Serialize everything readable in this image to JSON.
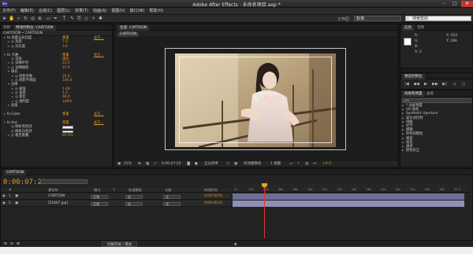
{
  "app": {
    "title": "Adobe After Effects - 未命名项目.aep *",
    "icon": "Ae"
  },
  "menu": [
    "文件(F)",
    "编辑(E)",
    "合成(C)",
    "图层(L)",
    "效果(T)",
    "动画(A)",
    "视图(V)",
    "窗口(W)",
    "帮助(H)"
  ],
  "toolbar": {
    "workspace_label": "工作区:",
    "workspace_value": "标准",
    "search_value": "搜索帮助"
  },
  "effects": {
    "tabs": [
      "项目",
      "特效控制台: CARTOON"
    ],
    "header": "CARTOON • CARTOON",
    "rows": [
      {
        "level": 0,
        "twirl": "▾",
        "name": "fx 亮度与对比度",
        "value": "重置",
        "about": "关于..."
      },
      {
        "level": 1,
        "twirl": "▸",
        "name": "◎ 亮度",
        "value": "7.0"
      },
      {
        "level": 1,
        "twirl": "▸",
        "name": "◎ 对比度",
        "value": "3.0"
      },
      {
        "level": 0,
        "twirl": "",
        "name": "",
        "value": ""
      },
      {
        "level": 0,
        "twirl": "▾",
        "name": "fx 卡通",
        "value": "重置",
        "about": "关于..."
      },
      {
        "level": 1,
        "twirl": "",
        "name": "◎ 渲染",
        "value": "填充"
      },
      {
        "level": 1,
        "twirl": "▸",
        "name": "◎ 详细半径",
        "value": "22.0"
      },
      {
        "level": 1,
        "twirl": "▸",
        "name": "◎ 详细阈值",
        "value": "15.0"
      },
      {
        "level": 1,
        "twirl": "▾",
        "name": "填充",
        "value": ""
      },
      {
        "level": 2,
        "twirl": "▸",
        "name": "◎ 阴影步数",
        "value": "25.0"
      },
      {
        "level": 2,
        "twirl": "▸",
        "name": "◎ 阴影平滑度",
        "value": "100.0"
      },
      {
        "level": 1,
        "twirl": "▾",
        "name": "边缘",
        "value": ""
      },
      {
        "level": 2,
        "twirl": "▸",
        "name": "◎ 阈值",
        "value": "1.00"
      },
      {
        "level": 2,
        "twirl": "▸",
        "name": "◎ 宽度",
        "value": "1.0"
      },
      {
        "level": 2,
        "twirl": "▸",
        "name": "◎ 柔化",
        "value": "60.0"
      },
      {
        "level": 2,
        "twirl": "▸",
        "name": "◎ 透明度",
        "value": "100%"
      },
      {
        "level": 1,
        "twirl": "▸",
        "name": "高级",
        "value": ""
      },
      {
        "level": 0,
        "twirl": "",
        "name": "",
        "value": ""
      },
      {
        "level": 0,
        "twirl": "▸",
        "name": "fx Color",
        "value": "重置",
        "about": "关于..."
      },
      {
        "level": 0,
        "twirl": "",
        "name": "",
        "value": ""
      },
      {
        "level": 0,
        "twirl": "▾",
        "name": "fx tint",
        "value": "重置",
        "about": "关于..."
      },
      {
        "level": 1,
        "twirl": "",
        "name": "◎ 映射黑色到",
        "value": "",
        "swatch": "#ffffff"
      },
      {
        "level": 1,
        "twirl": "",
        "name": "◎ 映射白色到",
        "value": "",
        "swatch": "#ffffff"
      },
      {
        "level": 1,
        "twirl": "▸",
        "name": "◎ 着色数量",
        "value": "65.0%"
      }
    ]
  },
  "composition": {
    "tabs": [
      "合成: CARTOON"
    ],
    "sub_tab": "CARTOON",
    "zoom": "25%",
    "timecode": "0:00:07:20",
    "resolution": "全分辨率",
    "camera": "有效摄像机",
    "views": "1 视图",
    "offset": "+0.0"
  },
  "info": {
    "tabs": [
      "信息",
      "音频"
    ],
    "r": "R:",
    "g": "G:",
    "b": "B:",
    "a": "A: 0",
    "x": "X: 622",
    "y": "Y: 288",
    "swatch_color": "#ffffff"
  },
  "preview": {
    "title": "预览控制台",
    "buttons": [
      "|◀",
      "◀◀",
      "▶",
      "▶▶",
      "▶|",
      "◁",
      "▢"
    ]
  },
  "presets": {
    "tabs": [
      "效果和预置",
      "画笔"
    ],
    "search": "ρ+",
    "items": [
      "* 动画预置",
      "3D 通道",
      "Synthetic Aperture",
      "表达式控制",
      "扭曲",
      "文字",
      "模糊",
      "杂色和颗粒",
      "噪波",
      "渐变",
      "通道",
      "颜色校正"
    ]
  },
  "timeline": {
    "tab": "CARTOON",
    "time": "0:00:07:20",
    "columns": [
      "#",
      "源名称",
      "模式",
      "T",
      "轨道蒙板",
      "父级",
      "持续时间"
    ],
    "layers": [
      {
        "num": "1",
        "name": "CARTOON",
        "mode": "正常",
        "trk": "无",
        "parent": "无",
        "duration": "0:00:00:01"
      },
      {
        "num": "2",
        "name": "[51807.jpg]",
        "mode": "正常",
        "trk": "无",
        "parent": "无",
        "duration": "0:00:00:01"
      }
    ],
    "ruler_ticks": [
      "0s",
      "02s",
      "04s",
      "06s",
      "08s",
      "10s",
      "12s",
      "14s",
      "16s",
      "18s",
      "20s",
      "22s",
      "24s",
      "26s",
      "28s",
      "01:0"
    ],
    "toggle_label": "切换开关 / 模式"
  },
  "colors": {
    "accent": "#e09a23",
    "playhead": "#e0332b"
  }
}
